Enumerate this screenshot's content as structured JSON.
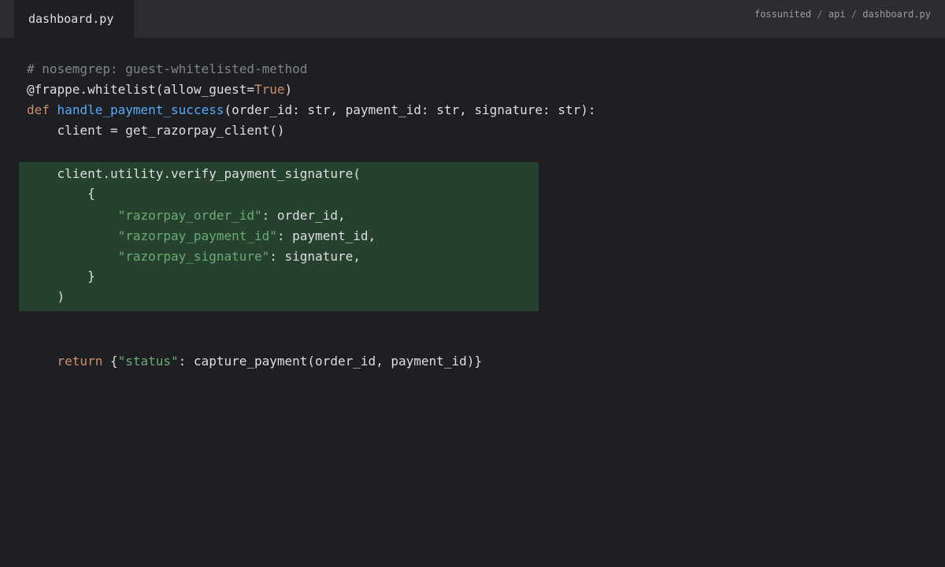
{
  "tab": {
    "filename": "dashboard.py"
  },
  "breadcrumb": {
    "parts": [
      "fossunited",
      "api",
      "dashboard.py"
    ],
    "separator": " / "
  },
  "code": {
    "comment": "# nosemgrep: guest-whitelisted-method",
    "decorator_prefix": "@frappe.whitelist(allow_guest=",
    "decorator_value": "True",
    "decorator_suffix": ")",
    "def_keyword": "def",
    "function_name": "handle_payment_success",
    "function_params": "(order_id: str, payment_id: str, signature: str):",
    "client_line": "    client = get_razorpay_client()",
    "verify_call": "    client.utility.verify_payment_signature(",
    "open_brace": "        {",
    "entries": [
      {
        "key": "\"razorpay_order_id\"",
        "value": ": order_id,"
      },
      {
        "key": "\"razorpay_payment_id\"",
        "value": ": payment_id,"
      },
      {
        "key": "\"razorpay_signature\"",
        "value": ": signature,"
      }
    ],
    "entry_indent": "            ",
    "close_brace": "        }",
    "close_paren": "    )",
    "return_indent": "    ",
    "return_keyword": "return",
    "return_open": " {",
    "return_key": "\"status\"",
    "return_rest": ": capture_payment(order_id, payment_id)}"
  },
  "colors": {
    "background": "#1e1f22",
    "tabbar": "#2b2d30",
    "highlight": "#27412f",
    "keyword": "#cf8e6d",
    "function": "#57aaf7",
    "string": "#6aab73",
    "comment": "#7f848e",
    "text": "#dcdfe4"
  }
}
